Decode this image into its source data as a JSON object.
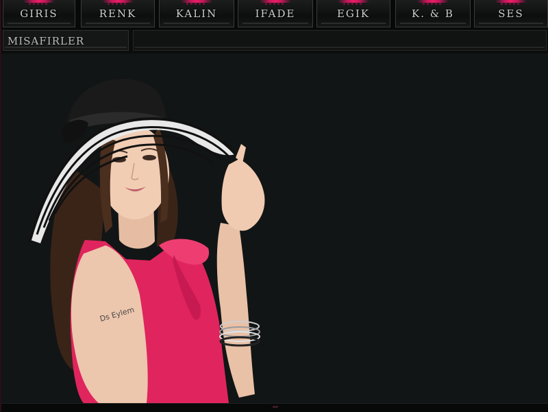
{
  "nav": {
    "tabs": [
      {
        "label": "GIRIS"
      },
      {
        "label": "RENK"
      },
      {
        "label": "KALIN"
      },
      {
        "label": "IFADE"
      },
      {
        "label": "EGIK"
      },
      {
        "label": "K. & B"
      },
      {
        "label": "SES"
      }
    ]
  },
  "subbar": {
    "guests_label": "MISAFIRLER"
  },
  "stage": {
    "tattoo_text": "Ds Eylem"
  },
  "colors": {
    "accent": "#e91e63",
    "background": "#121414",
    "dress": "#e0245e"
  }
}
